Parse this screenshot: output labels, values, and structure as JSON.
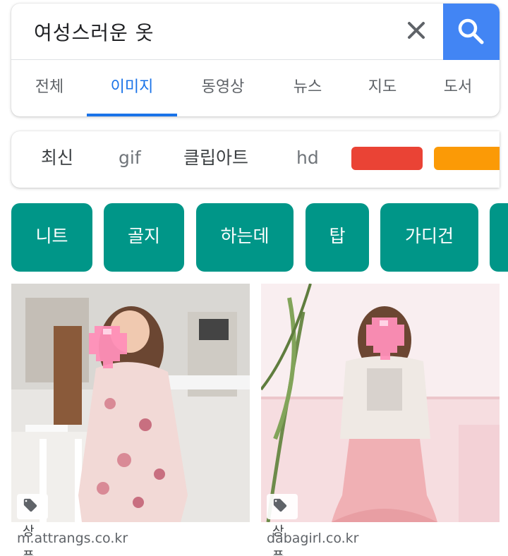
{
  "search": {
    "query": "여성스러운 옷",
    "clear_icon": "close-icon",
    "search_icon": "search-icon",
    "accent": "#4285f4"
  },
  "tabs": [
    {
      "label": "전체",
      "active": false
    },
    {
      "label": "이미지",
      "active": true
    },
    {
      "label": "동영상",
      "active": false
    },
    {
      "label": "뉴스",
      "active": false
    },
    {
      "label": "지도",
      "active": false
    },
    {
      "label": "도서",
      "active": false
    }
  ],
  "filters": {
    "items": [
      "최신",
      "gif",
      "클립아트",
      "hd"
    ],
    "color_swatches": [
      "#ea4335",
      "#fb9a06"
    ]
  },
  "chips": {
    "color": "#009688",
    "items": [
      "니트",
      "골지",
      "하는데",
      "탑",
      "가디건"
    ]
  },
  "results": [
    {
      "badge": "상품",
      "badge_icon": "tag-icon",
      "domain": "m.attrangs.co.kr"
    },
    {
      "badge": "상품",
      "badge_icon": "tag-icon",
      "domain": "dabagirl.co.kr"
    }
  ]
}
